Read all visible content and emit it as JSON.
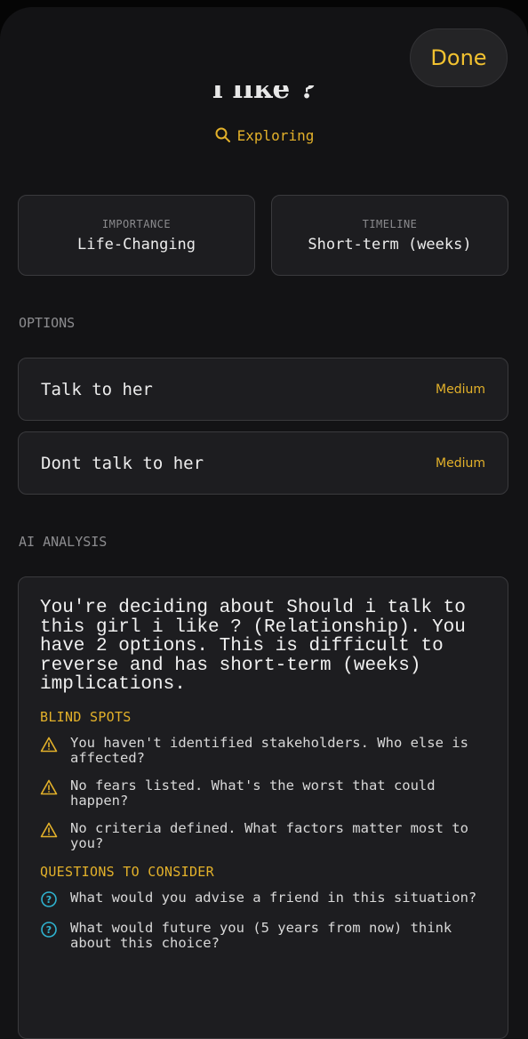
{
  "header": {
    "done_label": "Done",
    "title_fragment": "i like ?",
    "status_label": "Exploring"
  },
  "meta": [
    {
      "label": "IMPORTANCE",
      "value": "Life-Changing"
    },
    {
      "label": "TIMELINE",
      "value": "Short-term (weeks)"
    }
  ],
  "options_section": {
    "title": "OPTIONS",
    "items": [
      {
        "name": "Talk to her",
        "rating": "Medium"
      },
      {
        "name": "Dont talk to her",
        "rating": "Medium"
      }
    ]
  },
  "analysis": {
    "section_title": "AI ANALYSIS",
    "summary": "You're deciding about Should i talk to this girl i like ?  (Relationship). You have 2 options. This is difficult to reverse and has short-term (weeks) implications.",
    "blind_spots_title": "BLIND SPOTS",
    "blind_spots": [
      "You haven't identified stakeholders. Who else is affected?",
      "No fears listed. What's the worst that could happen?",
      "No criteria defined. What factors matter most to you?"
    ],
    "questions_title": "QUESTIONS TO CONSIDER",
    "questions": [
      "What would you advise a friend in this situation?",
      "What would future you (5 years from now) think about this choice?"
    ]
  },
  "colors": {
    "accent": "#e3b12a",
    "question_icon": "#2fb3d0",
    "background": "#131315",
    "card": "#1d1d20"
  },
  "icons": {
    "status": "search-icon",
    "blind_spot": "warning-icon",
    "question": "question-circle-icon"
  }
}
